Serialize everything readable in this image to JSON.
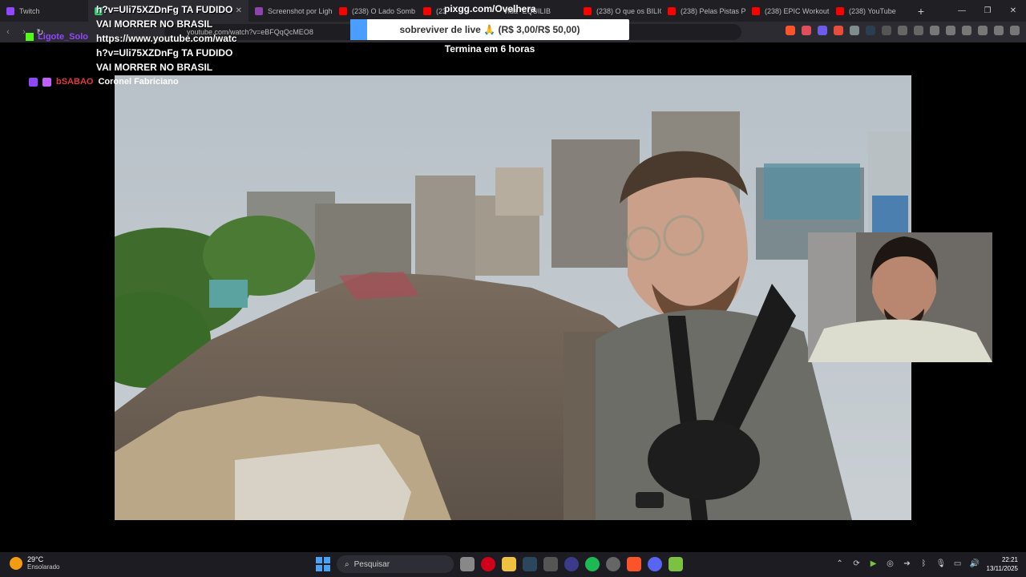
{
  "tabs": [
    {
      "label": "Twitch",
      "color": "#9147ff"
    },
    {
      "label": "h?v=Uli75XZDnFg TA FUDIDO",
      "color": "#2ecc71",
      "active": true
    },
    {
      "label": "Screenshot por Ligh",
      "color": "#8e44ad"
    },
    {
      "label": "(238) O Lado Somb",
      "color": "#ff0000"
    },
    {
      "label": "(23",
      "color": "#ff0000"
    },
    {
      "label": "Vida \"EQUILIB",
      "color": "#ff0000"
    },
    {
      "label": "(238) O que os BILIO",
      "color": "#ff0000"
    },
    {
      "label": "(238) Pelas Pistas P",
      "color": "#ff0000"
    },
    {
      "label": "(238) EPIC Workout",
      "color": "#ff0000"
    },
    {
      "label": "(238) YouTube",
      "color": "#ff0000"
    }
  ],
  "url": "youtube.com/watch?v=eBFQqQcMEO8",
  "overlay": {
    "chat_lines": [
      "h?v=Uli75XZDnFg TA FUDIDO",
      "VAI MORRER NO BRASIL",
      "https://www.youtube.com/watc",
      "h?v=Uli75XZDnFg TA FUDIDO",
      "VAI MORRER NO BRASIL"
    ],
    "chat_user": "Ligote_Solo",
    "chat_user2": "bSABAO",
    "chat_user2_msg": "Coronel Fabriciano",
    "pixgg": "pixgg.com/Ovelhera",
    "goal_text": "sobreviver de live 🙏 (R$ 3,00/R$ 50,00)",
    "goal_progress": 0.06,
    "ends_text": "Termina em 6 horas"
  },
  "taskbar": {
    "temp": "29°C",
    "weather": "Ensolarado",
    "search": "Pesquisar",
    "time": "22:21",
    "date": "13/11/2025"
  },
  "colors": {
    "accent": "#4a9eff",
    "twitch": "#9147ff",
    "chat_red": "#e23b3b"
  }
}
